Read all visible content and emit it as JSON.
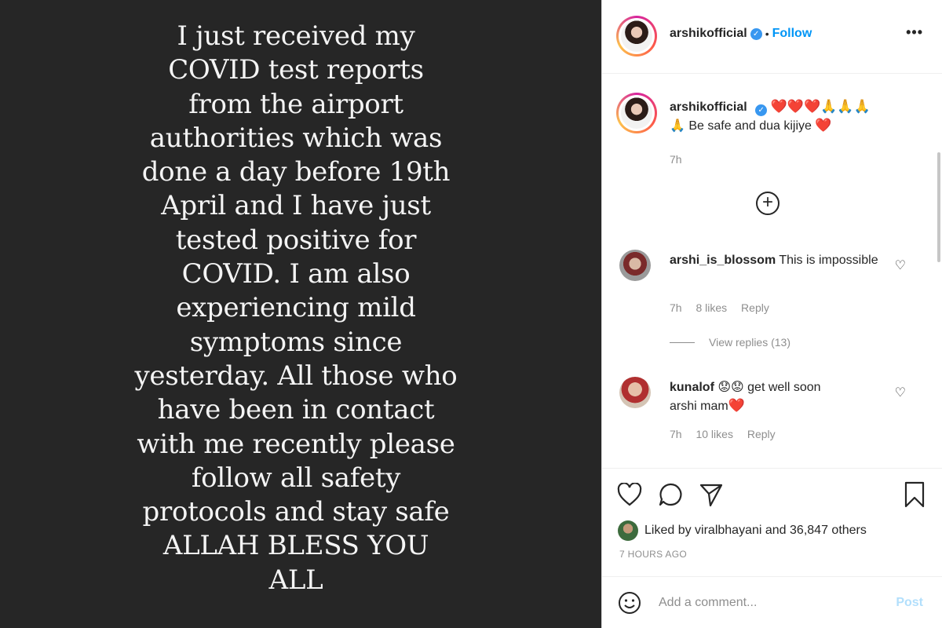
{
  "story": {
    "text": "I just received my\nCOVID test reports\nfrom the airport\nauthorities which was\ndone a day before 19th\nApril and I have just\ntested positive for\nCOVID. I am also\nexperiencing mild\nsymptoms since\nyesterday. All those who\nhave been in contact\nwith me recently please\nfollow all safety\nprotocols and stay safe\nALLAH BLESS YOU\nALL"
  },
  "header": {
    "username": "arshikofficial",
    "follow_label": "Follow",
    "more_label": "•••"
  },
  "caption": {
    "username": "arshikofficial",
    "line1_emojis": "❤️❤️❤️🙏🙏🙏",
    "pray": "🙏",
    "text": "Be safe and dua kijiye",
    "heart": "❤️",
    "time": "7h"
  },
  "comments": [
    {
      "username": "arshi_is_blossom",
      "text": "This is impossible",
      "time": "7h",
      "likes": "8 likes",
      "reply_label": "Reply",
      "view_replies": "View replies (13)"
    },
    {
      "username": "kunalof",
      "emojis": "😟😟",
      "text": "get well soon",
      "text2": "arshi mam",
      "heart": "❤️",
      "time": "7h",
      "likes": "10 likes",
      "reply_label": "Reply"
    }
  ],
  "footer": {
    "liked_by_prefix": "Liked by ",
    "liked_by_user": "viralbhayani",
    "liked_by_suffix": " and ",
    "liked_by_others": "36,847 others",
    "timestamp": "7 HOURS AGO",
    "comment_placeholder": "Add a comment...",
    "post_label": "Post"
  },
  "colors": {
    "media_bg": "#262626",
    "link_blue": "#0095f6",
    "post_disabled": "#b2dffc",
    "heart_red": "#ed1c24"
  }
}
